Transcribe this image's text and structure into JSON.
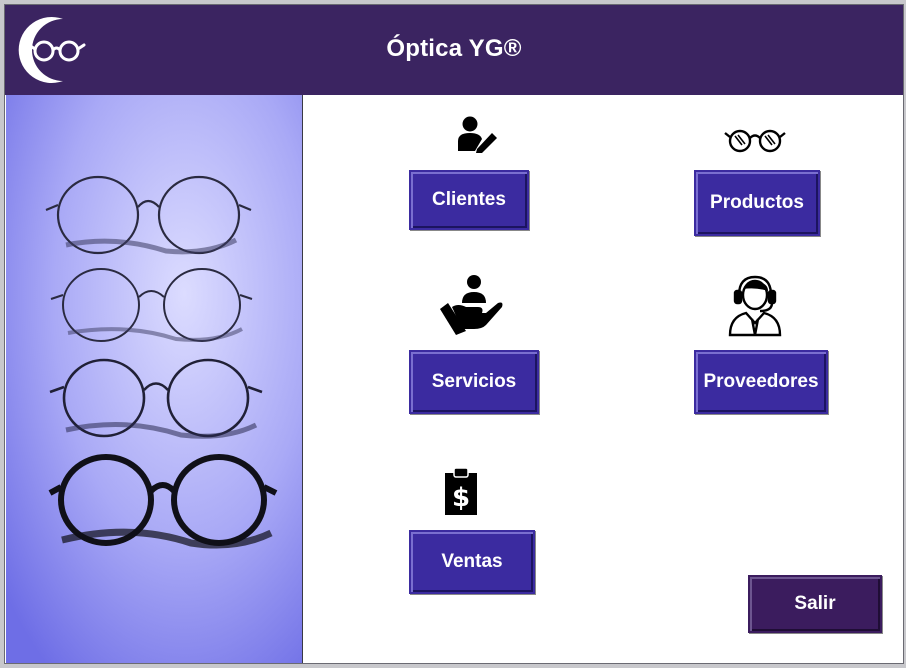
{
  "app": {
    "title": "Óptica YG®"
  },
  "menu": {
    "clientes": {
      "label": "Clientes",
      "icon": "user-edit-icon"
    },
    "productos": {
      "label": "Productos",
      "icon": "glasses-icon"
    },
    "servicios": {
      "label": "Servicios",
      "icon": "hand-service-icon"
    },
    "proveedores": {
      "label": "Proveedores",
      "icon": "headset-support-icon"
    },
    "ventas": {
      "label": "Ventas",
      "icon": "clipboard-dollar-icon"
    },
    "salir": {
      "label": "Salir"
    }
  },
  "colors": {
    "header": "#3b2461",
    "button": "#3b2ba0",
    "exit_button": "#3b1c5e",
    "photo_tint": "#8c8cf2"
  }
}
